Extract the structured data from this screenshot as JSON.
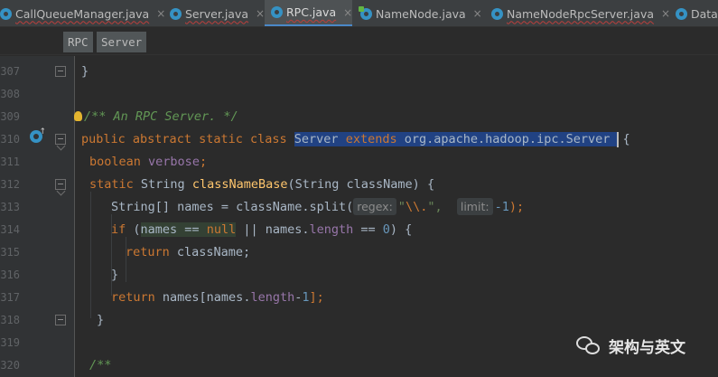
{
  "tabs": [
    {
      "label": "CallQueueManager.java",
      "icon": "class-icon",
      "active": false
    },
    {
      "label": "Server.java",
      "icon": "class-icon",
      "active": false
    },
    {
      "label": "RPC.java",
      "icon": "class-icon",
      "active": true
    },
    {
      "label": "NameNode.java",
      "icon": "class-icon",
      "active": false
    },
    {
      "label": "NameNodeRpcServer.java",
      "icon": "class-icon",
      "active": false
    },
    {
      "label": "DataI",
      "icon": "class-icon",
      "active": false
    }
  ],
  "tab_close_glyph": "×",
  "breadcrumb": [
    "RPC",
    "Server"
  ],
  "line_numbers": [
    "307",
    "308",
    "309",
    "310",
    "311",
    "312",
    "313",
    "314",
    "315",
    "316",
    "317",
    "318",
    "319",
    "320"
  ],
  "code": {
    "l307": {
      "brace": "}"
    },
    "l309": {
      "comment": "/** An RPC Server. */"
    },
    "l310": {
      "kw1": "public",
      "kw2": "abstract",
      "kw3": "static",
      "kw4": "class",
      "name": "Server",
      "kw5": "extends",
      "base": "org.apache.hadoop.ipc.Server",
      "brace": "{"
    },
    "l311": {
      "type": "boolean",
      "field": "verbose",
      "semi": ";"
    },
    "l312": {
      "kw": "static",
      "type": "String",
      "method": "classNameBase",
      "params": "(String className) {"
    },
    "l313": {
      "lhs": "String[] names = className.split(",
      "hint1": "regex:",
      "str_open": "\"",
      "esc": "\\\\.",
      "str_close": "\",",
      "hint2": "limit:",
      "num": "-1",
      "tail": ");"
    },
    "l314": {
      "kw": "if",
      "open": " (",
      "ident": "names",
      "eq": " == ",
      "kw_null": "null",
      "mid": " || names.",
      "field": "length",
      "cmp": " == ",
      "num": "0",
      "tail": ") {"
    },
    "l315": {
      "kw": "return",
      "rest": " className;"
    },
    "l316": {
      "brace": "}"
    },
    "l317": {
      "kw": "return",
      "rest": " names[names.",
      "field": "length",
      "minus": "-",
      "num": "1",
      "tail": "];"
    },
    "l318": {
      "brace": "}"
    },
    "l320": {
      "doc": "/**"
    }
  },
  "watermark": "架构与英文",
  "colors": {
    "selection": "#214283",
    "keyword": "#cc7832",
    "method": "#ffc66d",
    "field": "#9876aa",
    "number": "#6897bb",
    "comment": "#629755",
    "string": "#6a8759",
    "accent": "#4a88c7"
  }
}
